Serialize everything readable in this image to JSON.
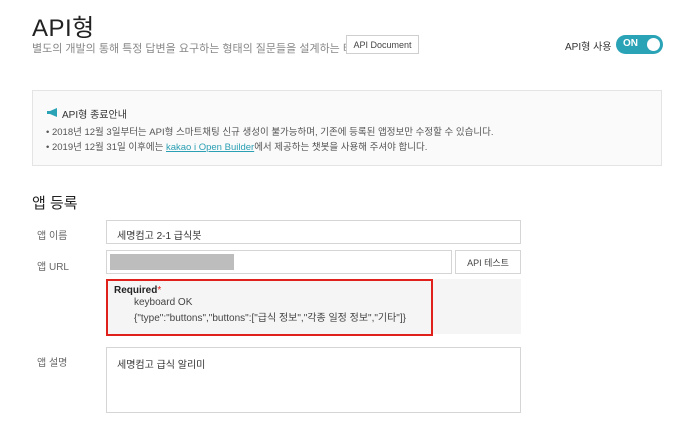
{
  "header": {
    "title": "API형",
    "subtitle": "별도의 개발의 통해 특정 답변을 요구하는 형태의 질문들을 설계하는 타입입니다.",
    "doc_button": "API Document",
    "api_use_label": "API형 사용",
    "toggle_label": "ON"
  },
  "notice": {
    "icon": "megaphone-icon",
    "title": "API형 종료안내",
    "items": [
      "2018년 12월 3일부터는 API형 스마트채팅 신규 생성이 불가능하며, 기존에 등록된 앱정보만 수정할 수 있습니다.",
      {
        "prefix": "2019년 12월 31일 이후에는 ",
        "link": "kakao i Open Builder",
        "suffix": "에서 제공하는 챗봇을 사용해 주셔야 합니다."
      }
    ]
  },
  "form": {
    "section_title": "앱 등록",
    "app_name_label": "앱 이름",
    "app_name_value": "세명컴고 2-1 급식봇",
    "app_url_label": "앱 URL",
    "api_test_button": "API 테스트",
    "required_title": "Required",
    "required_star": "*",
    "required_lines": [
      "keyboard OK",
      "{\"type\":\"buttons\",\"buttons\":[\"급식 정보\",\"각종 일정 정보\",\"기타\"]}"
    ],
    "app_desc_label": "앱 설명",
    "app_desc_value": "세명컴고 급식 알리미"
  },
  "colors": {
    "accent": "#2aa3b6",
    "highlight": "#e0201b"
  }
}
